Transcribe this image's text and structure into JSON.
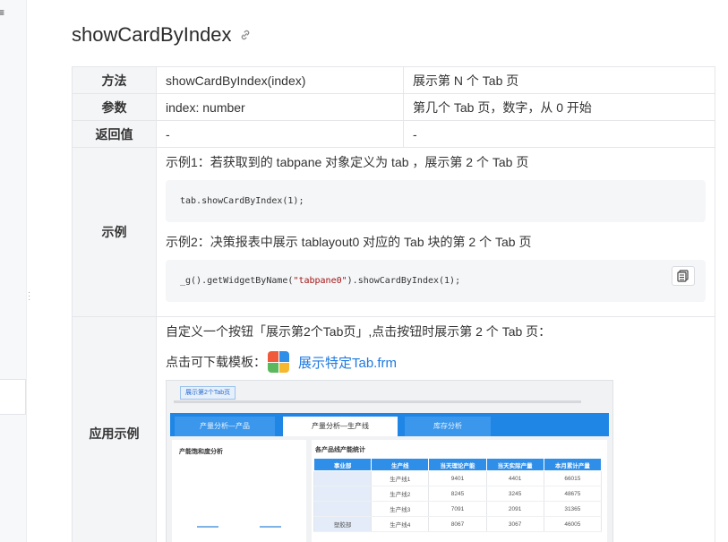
{
  "page": {
    "title": "showCardByIndex"
  },
  "table": {
    "rows": {
      "method": {
        "header": "方法",
        "col1": "showCardByIndex(index)",
        "col2": "展示第 N 个 Tab 页"
      },
      "params": {
        "header": "参数",
        "col1": "index: number",
        "col2": "第几个 Tab 页，数字，从 0 开始"
      },
      "returns": {
        "header": "返回值",
        "col1": "-",
        "col2": "-"
      }
    },
    "example": {
      "header": "示例",
      "example1_text": "示例1：若获取到的 tabpane 对象定义为 tab ，展示第 2 个 Tab 页",
      "example1_code": "tab.showCardByIndex(1);",
      "example2_text": "示例2：决策报表中展示 tablayout0 对应的 Tab 块的第 2 个 Tab 页",
      "example2_code_pre": "_g().getWidgetByName(",
      "example2_code_str": "\"tabpane0\"",
      "example2_code_post": ").showCardByIndex(1);"
    },
    "application": {
      "header": "应用示例",
      "description": "自定义一个按钮「展示第2个Tab页」,点击按钮时展示第 2 个 Tab 页：",
      "download_label": "点击可下载模板：",
      "download_link": "展示特定Tab.frm"
    }
  },
  "preview": {
    "button": "展示第2个Tab页",
    "tabs": [
      "产量分析—产品",
      "产量分析—生产线",
      "库存分析"
    ],
    "left_title": "产能饱和度分析",
    "right_title": "各产品线产能统计",
    "columns": [
      "事业部",
      "生产线",
      "当天理论产能",
      "当天实际产量",
      "本月累计产量"
    ],
    "rows": [
      [
        "",
        "生产线1",
        "9401",
        "4401",
        "66015"
      ],
      [
        "",
        "生产线2",
        "8245",
        "3245",
        "48675"
      ],
      [
        "",
        "生产线3",
        "7091",
        "2091",
        "31365"
      ],
      [
        "塑胶部",
        "生产线4",
        "8067",
        "3067",
        "46005"
      ]
    ]
  },
  "colors": {
    "link": "#1f7ae0",
    "tab_bar": "#1f86e6",
    "code_string": "#a31515"
  }
}
